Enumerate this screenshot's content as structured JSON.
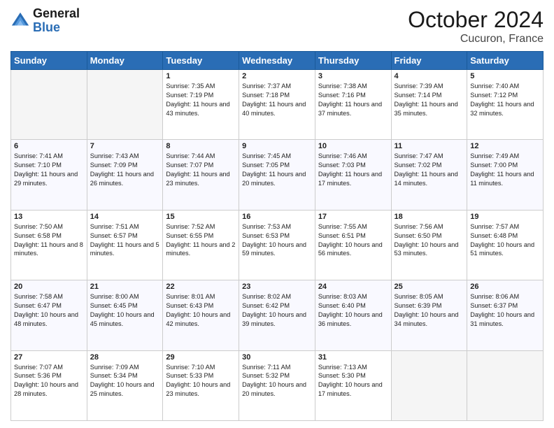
{
  "header": {
    "logo_line1": "General",
    "logo_line2": "Blue",
    "month": "October 2024",
    "location": "Cucuron, France"
  },
  "weekdays": [
    "Sunday",
    "Monday",
    "Tuesday",
    "Wednesday",
    "Thursday",
    "Friday",
    "Saturday"
  ],
  "weeks": [
    [
      {
        "day": "",
        "sunrise": "",
        "sunset": "",
        "daylight": ""
      },
      {
        "day": "",
        "sunrise": "",
        "sunset": "",
        "daylight": ""
      },
      {
        "day": "1",
        "sunrise": "Sunrise: 7:35 AM",
        "sunset": "Sunset: 7:19 PM",
        "daylight": "Daylight: 11 hours and 43 minutes."
      },
      {
        "day": "2",
        "sunrise": "Sunrise: 7:37 AM",
        "sunset": "Sunset: 7:18 PM",
        "daylight": "Daylight: 11 hours and 40 minutes."
      },
      {
        "day": "3",
        "sunrise": "Sunrise: 7:38 AM",
        "sunset": "Sunset: 7:16 PM",
        "daylight": "Daylight: 11 hours and 37 minutes."
      },
      {
        "day": "4",
        "sunrise": "Sunrise: 7:39 AM",
        "sunset": "Sunset: 7:14 PM",
        "daylight": "Daylight: 11 hours and 35 minutes."
      },
      {
        "day": "5",
        "sunrise": "Sunrise: 7:40 AM",
        "sunset": "Sunset: 7:12 PM",
        "daylight": "Daylight: 11 hours and 32 minutes."
      }
    ],
    [
      {
        "day": "6",
        "sunrise": "Sunrise: 7:41 AM",
        "sunset": "Sunset: 7:10 PM",
        "daylight": "Daylight: 11 hours and 29 minutes."
      },
      {
        "day": "7",
        "sunrise": "Sunrise: 7:43 AM",
        "sunset": "Sunset: 7:09 PM",
        "daylight": "Daylight: 11 hours and 26 minutes."
      },
      {
        "day": "8",
        "sunrise": "Sunrise: 7:44 AM",
        "sunset": "Sunset: 7:07 PM",
        "daylight": "Daylight: 11 hours and 23 minutes."
      },
      {
        "day": "9",
        "sunrise": "Sunrise: 7:45 AM",
        "sunset": "Sunset: 7:05 PM",
        "daylight": "Daylight: 11 hours and 20 minutes."
      },
      {
        "day": "10",
        "sunrise": "Sunrise: 7:46 AM",
        "sunset": "Sunset: 7:03 PM",
        "daylight": "Daylight: 11 hours and 17 minutes."
      },
      {
        "day": "11",
        "sunrise": "Sunrise: 7:47 AM",
        "sunset": "Sunset: 7:02 PM",
        "daylight": "Daylight: 11 hours and 14 minutes."
      },
      {
        "day": "12",
        "sunrise": "Sunrise: 7:49 AM",
        "sunset": "Sunset: 7:00 PM",
        "daylight": "Daylight: 11 hours and 11 minutes."
      }
    ],
    [
      {
        "day": "13",
        "sunrise": "Sunrise: 7:50 AM",
        "sunset": "Sunset: 6:58 PM",
        "daylight": "Daylight: 11 hours and 8 minutes."
      },
      {
        "day": "14",
        "sunrise": "Sunrise: 7:51 AM",
        "sunset": "Sunset: 6:57 PM",
        "daylight": "Daylight: 11 hours and 5 minutes."
      },
      {
        "day": "15",
        "sunrise": "Sunrise: 7:52 AM",
        "sunset": "Sunset: 6:55 PM",
        "daylight": "Daylight: 11 hours and 2 minutes."
      },
      {
        "day": "16",
        "sunrise": "Sunrise: 7:53 AM",
        "sunset": "Sunset: 6:53 PM",
        "daylight": "Daylight: 10 hours and 59 minutes."
      },
      {
        "day": "17",
        "sunrise": "Sunrise: 7:55 AM",
        "sunset": "Sunset: 6:51 PM",
        "daylight": "Daylight: 10 hours and 56 minutes."
      },
      {
        "day": "18",
        "sunrise": "Sunrise: 7:56 AM",
        "sunset": "Sunset: 6:50 PM",
        "daylight": "Daylight: 10 hours and 53 minutes."
      },
      {
        "day": "19",
        "sunrise": "Sunrise: 7:57 AM",
        "sunset": "Sunset: 6:48 PM",
        "daylight": "Daylight: 10 hours and 51 minutes."
      }
    ],
    [
      {
        "day": "20",
        "sunrise": "Sunrise: 7:58 AM",
        "sunset": "Sunset: 6:47 PM",
        "daylight": "Daylight: 10 hours and 48 minutes."
      },
      {
        "day": "21",
        "sunrise": "Sunrise: 8:00 AM",
        "sunset": "Sunset: 6:45 PM",
        "daylight": "Daylight: 10 hours and 45 minutes."
      },
      {
        "day": "22",
        "sunrise": "Sunrise: 8:01 AM",
        "sunset": "Sunset: 6:43 PM",
        "daylight": "Daylight: 10 hours and 42 minutes."
      },
      {
        "day": "23",
        "sunrise": "Sunrise: 8:02 AM",
        "sunset": "Sunset: 6:42 PM",
        "daylight": "Daylight: 10 hours and 39 minutes."
      },
      {
        "day": "24",
        "sunrise": "Sunrise: 8:03 AM",
        "sunset": "Sunset: 6:40 PM",
        "daylight": "Daylight: 10 hours and 36 minutes."
      },
      {
        "day": "25",
        "sunrise": "Sunrise: 8:05 AM",
        "sunset": "Sunset: 6:39 PM",
        "daylight": "Daylight: 10 hours and 34 minutes."
      },
      {
        "day": "26",
        "sunrise": "Sunrise: 8:06 AM",
        "sunset": "Sunset: 6:37 PM",
        "daylight": "Daylight: 10 hours and 31 minutes."
      }
    ],
    [
      {
        "day": "27",
        "sunrise": "Sunrise: 7:07 AM",
        "sunset": "Sunset: 5:36 PM",
        "daylight": "Daylight: 10 hours and 28 minutes."
      },
      {
        "day": "28",
        "sunrise": "Sunrise: 7:09 AM",
        "sunset": "Sunset: 5:34 PM",
        "daylight": "Daylight: 10 hours and 25 minutes."
      },
      {
        "day": "29",
        "sunrise": "Sunrise: 7:10 AM",
        "sunset": "Sunset: 5:33 PM",
        "daylight": "Daylight: 10 hours and 23 minutes."
      },
      {
        "day": "30",
        "sunrise": "Sunrise: 7:11 AM",
        "sunset": "Sunset: 5:32 PM",
        "daylight": "Daylight: 10 hours and 20 minutes."
      },
      {
        "day": "31",
        "sunrise": "Sunrise: 7:13 AM",
        "sunset": "Sunset: 5:30 PM",
        "daylight": "Daylight: 10 hours and 17 minutes."
      },
      {
        "day": "",
        "sunrise": "",
        "sunset": "",
        "daylight": ""
      },
      {
        "day": "",
        "sunrise": "",
        "sunset": "",
        "daylight": ""
      }
    ]
  ]
}
